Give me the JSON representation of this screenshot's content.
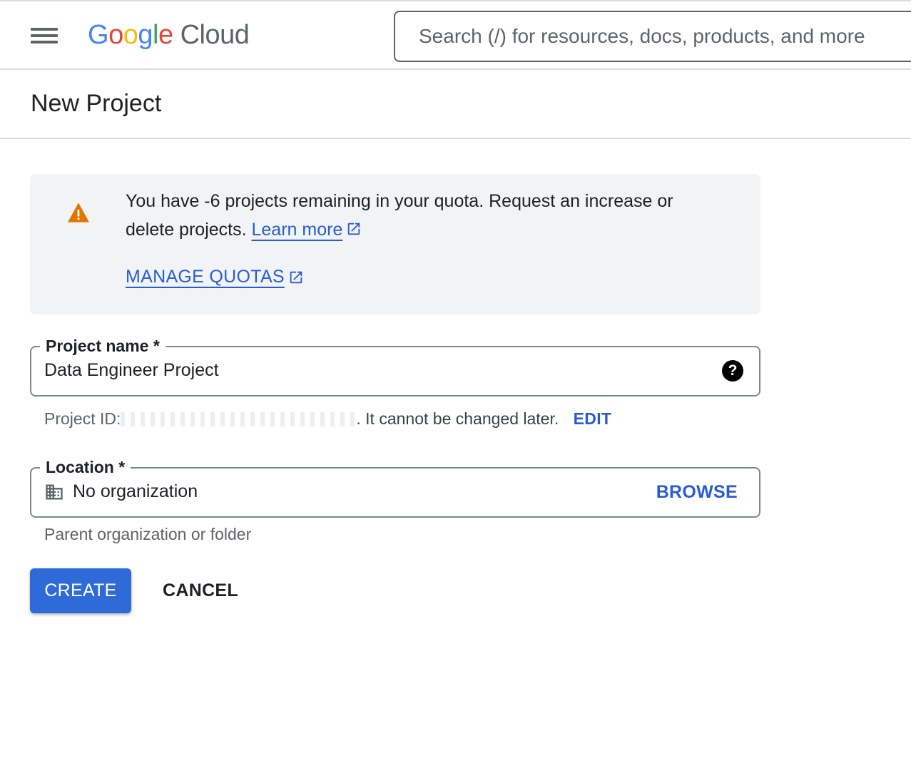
{
  "header": {
    "logo_google": "Google",
    "logo_cloud": "Cloud",
    "search_placeholder": "Search (/) for resources, docs, products, and more"
  },
  "page": {
    "title": "New Project"
  },
  "alert": {
    "message": "You have -6 projects remaining in your quota. Request an increase or delete projects.",
    "learn_more": "Learn more",
    "manage_quotas": "MANAGE QUOTAS",
    "icon": "warning-icon",
    "color": "#e37400"
  },
  "form": {
    "project_name": {
      "label": "Project name *",
      "value": "Data Engineer Project"
    },
    "project_id_hint": {
      "prefix": "Project ID:",
      "suffix": ". It cannot be changed later.",
      "edit": "EDIT"
    },
    "location": {
      "label": "Location *",
      "value": "No organization",
      "browse": "BROWSE",
      "hint": "Parent organization or folder"
    }
  },
  "actions": {
    "create": "CREATE",
    "cancel": "CANCEL"
  },
  "colors": {
    "accent": "#2f6ad9",
    "link": "#2a5bd7",
    "warning": "#e37400"
  }
}
